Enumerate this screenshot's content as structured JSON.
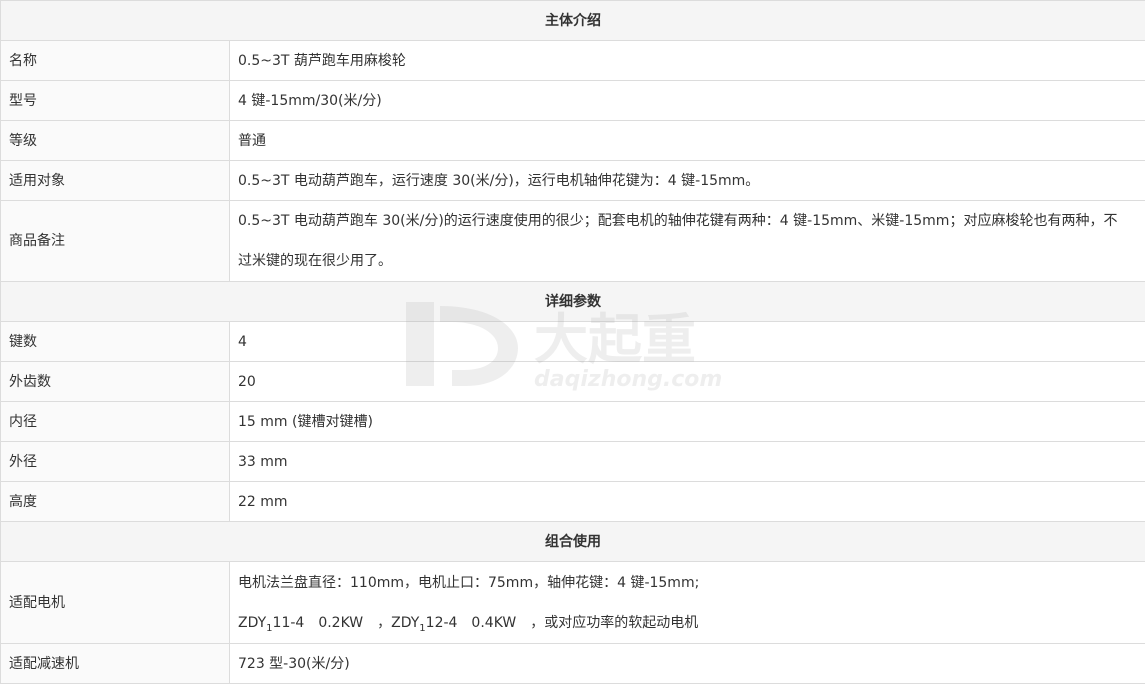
{
  "sections": [
    {
      "title": "主体介绍",
      "rows": [
        {
          "label": "名称",
          "value": "0.5~3T 葫芦跑车用麻梭轮"
        },
        {
          "label": "型号",
          "value": "4 键-15mm/30(米/分)"
        },
        {
          "label": "等级",
          "value": "普通"
        },
        {
          "label": "适用对象",
          "value": "0.5~3T 电动葫芦跑车，运行速度 30(米/分)，运行电机轴伸花键为：4 键-15mm。"
        },
        {
          "label": "商品备注",
          "value_lines": [
            "0.5~3T 电动葫芦跑车 30(米/分)的运行速度使用的很少；配套电机的轴伸花键有两种：4 键-15mm、米键-15mm；对应麻梭轮也有两种，不",
            "过米键的现在很少用了。"
          ]
        }
      ]
    },
    {
      "title": "详细参数",
      "rows": [
        {
          "label": "键数",
          "value": "4"
        },
        {
          "label": "外齿数",
          "value": "20"
        },
        {
          "label": "内径",
          "value": "15 mm (键槽对键槽)"
        },
        {
          "label": "外径",
          "value": "33 mm"
        },
        {
          "label": "高度",
          "value": "22 mm"
        }
      ]
    },
    {
      "title": "组合使用",
      "rows": [
        {
          "label": "适配电机",
          "line1": "电机法兰盘直径：110mm，电机止口：75mm，轴伸花键：4 键-15mm;",
          "line2": {
            "a_pre": "ZDY",
            "a_sub": "1",
            "a_post": "11-4　0.2KW　，",
            "b_pre": "ZDY",
            "b_sub": "1",
            "b_post": "12-4　0.4KW　，或对应功率的软起动电机"
          }
        },
        {
          "label": "适配减速机",
          "value": "723 型-30(米/分)"
        }
      ]
    }
  ],
  "watermark": {
    "cn": "大起重",
    "url": "daqizhong.com",
    "color": "#b0b0b0"
  }
}
